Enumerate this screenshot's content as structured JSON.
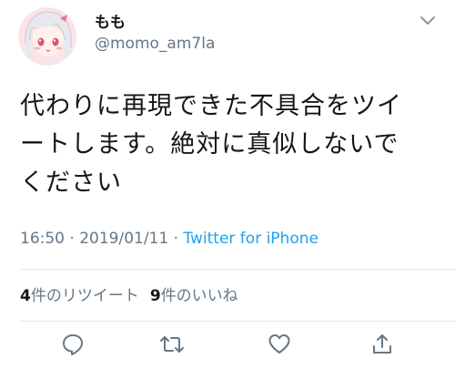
{
  "author": {
    "display_name": "もも",
    "handle": "@momo_am7la"
  },
  "tweet": {
    "lines": [
      "代わりに再現できた不具合をツイ",
      "ートします。絶対に真似しないで",
      "ください"
    ]
  },
  "meta": {
    "time": "16:50",
    "separator1": " · ",
    "date": "2019/01/11",
    "separator2": " · ",
    "source": "Twitter for iPhone"
  },
  "stats": {
    "retweet_count": "4",
    "retweet_label": "件のリツイート",
    "like_count": "9",
    "like_label": "件のいいね"
  },
  "actions": {
    "reply": "reply-icon",
    "retweet": "retweet-icon",
    "like": "heart-icon",
    "share": "share-icon"
  },
  "colors": {
    "text": "#14171a",
    "secondary": "#657786",
    "link": "#1da1f2",
    "divider": "#e1e8ed"
  }
}
